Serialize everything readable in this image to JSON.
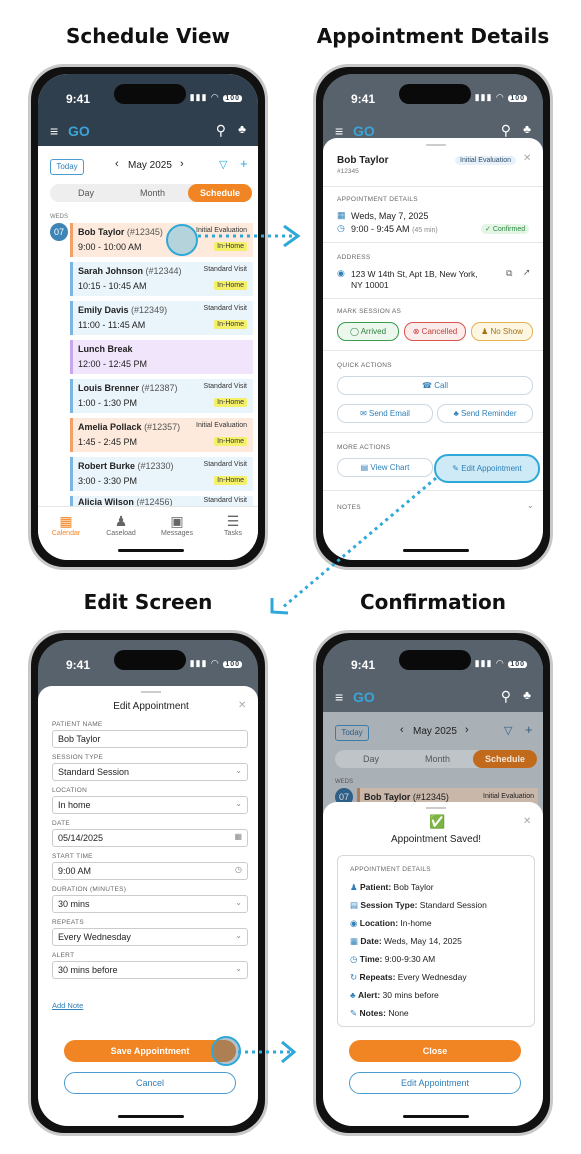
{
  "titles": {
    "schedule_view": "Schedule View",
    "appointment_details": "Appointment Details",
    "edit_screen": "Edit Screen",
    "confirmation": "Confirmation"
  },
  "status": {
    "time": "9:41",
    "signal": "▮▮▮ ◠",
    "battery": "100"
  },
  "app": {
    "logo": "GO"
  },
  "schedule": {
    "today_btn": "Today",
    "month_label": "May 2025",
    "tabs": [
      "Day",
      "Month",
      "Schedule"
    ],
    "day_label": "WEDS",
    "day_number": "07",
    "appointments": [
      {
        "name": "Bob Taylor",
        "id": "(#12345)",
        "time": "9:00 - 10:00 AM",
        "type": "Initial Evaluation",
        "tag": "In-Home",
        "style": "initial"
      },
      {
        "name": "Sarah Johnson",
        "id": "(#12344)",
        "time": "10:15 - 10:45 AM",
        "type": "Standard Visit",
        "tag": "In-Home",
        "style": "standard"
      },
      {
        "name": "Emily Davis",
        "id": "(#12349)",
        "time": "11:00 - 11:45 AM",
        "type": "Standard Visit",
        "tag": "In-Home",
        "style": "standard"
      },
      {
        "name": "Lunch Break",
        "id": "",
        "time": "12:00 - 12:45 PM",
        "type": "",
        "tag": "",
        "style": "break"
      },
      {
        "name": "Louis Brenner",
        "id": "(#12387)",
        "time": "1:00 - 1:30 PM",
        "type": "Standard Visit",
        "tag": "In-Home",
        "style": "standard"
      },
      {
        "name": "Amelia Pollack",
        "id": "(#12357)",
        "time": "1:45 - 2:45 PM",
        "type": "Initial Evaluation",
        "tag": "In-Home",
        "style": "initial"
      },
      {
        "name": "Robert Burke",
        "id": "(#12330)",
        "time": "3:00 - 3:30 PM",
        "type": "Standard Visit",
        "tag": "In-Home",
        "style": "standard"
      },
      {
        "name": "Alicia Wilson",
        "id": "(#12456)",
        "time": "",
        "type": "Standard Visit",
        "tag": "",
        "style": "standard"
      }
    ],
    "nav": [
      "Calendar",
      "Caseload",
      "Messages",
      "Tasks"
    ]
  },
  "details": {
    "name": "Bob Taylor",
    "id": "#12345",
    "badge": "Initial Evaluation",
    "section_appt": "APPOINTMENT DETAILS",
    "date": "Weds, May 7, 2025",
    "time": "9:00 - 9:45 AM",
    "duration": "(45 min)",
    "confirmed": "Confirmed",
    "section_address": "ADDRESS",
    "address_line1": "123 W 14th St, Apt 1B, New York,",
    "address_line2": "NY 10001",
    "section_mark": "MARK SESSION AS",
    "arrived": "Arrived",
    "cancelled": "Cancelled",
    "noshow": "No Show",
    "section_quick": "QUICK ACTIONS",
    "call": "Call",
    "send_email": "Send Email",
    "send_reminder": "Send Reminder",
    "section_more": "MORE ACTIONS",
    "view_chart": "View Chart",
    "edit_appointment": "Edit Appointment",
    "notes": "NOTES"
  },
  "edit": {
    "title": "Edit Appointment",
    "fields": [
      {
        "label": "PATIENT NAME",
        "value": "Bob Taylor",
        "icon": ""
      },
      {
        "label": "SESSION TYPE",
        "value": "Standard Session",
        "icon": "chevron"
      },
      {
        "label": "LOCATION",
        "value": "In home",
        "icon": "chevron"
      },
      {
        "label": "DATE",
        "value": "05/14/2025",
        "icon": "calendar"
      },
      {
        "label": "START TIME",
        "value": "9:00 AM",
        "icon": "clock"
      },
      {
        "label": "DURATION (MINUTES)",
        "value": "30 mins",
        "icon": "chevron"
      },
      {
        "label": "REPEATS",
        "value": "Every Wednesday",
        "icon": "chevron"
      },
      {
        "label": "ALERT",
        "value": "30 mins before",
        "icon": "chevron"
      }
    ],
    "add_note": "Add Note",
    "save": "Save Appointment",
    "cancel": "Cancel"
  },
  "confirm": {
    "title": "Appointment Saved!",
    "section": "APPOINTMENT DETAILS",
    "rows": [
      {
        "label": "Patient:",
        "value": "Bob Taylor",
        "icon": "person"
      },
      {
        "label": "Session Type:",
        "value": "Standard Session",
        "icon": "clipboard"
      },
      {
        "label": "Location:",
        "value": "In-home",
        "icon": "pin"
      },
      {
        "label": "Date:",
        "value": "Weds, May 14, 2025",
        "icon": "calendar"
      },
      {
        "label": "Time:",
        "value": "9:00-9:30 AM",
        "icon": "clock"
      },
      {
        "label": "Repeats:",
        "value": "Every Wednesday",
        "icon": "repeat"
      },
      {
        "label": "Alert:",
        "value": "30 mins before",
        "icon": "bell"
      },
      {
        "label": "Notes:",
        "value": "None",
        "icon": "note"
      }
    ],
    "close": "Close",
    "edit": "Edit Appointment"
  },
  "colors": {
    "orange": "#f28523",
    "navy": "#2f3f4d",
    "blue": "#2ea8d8"
  }
}
